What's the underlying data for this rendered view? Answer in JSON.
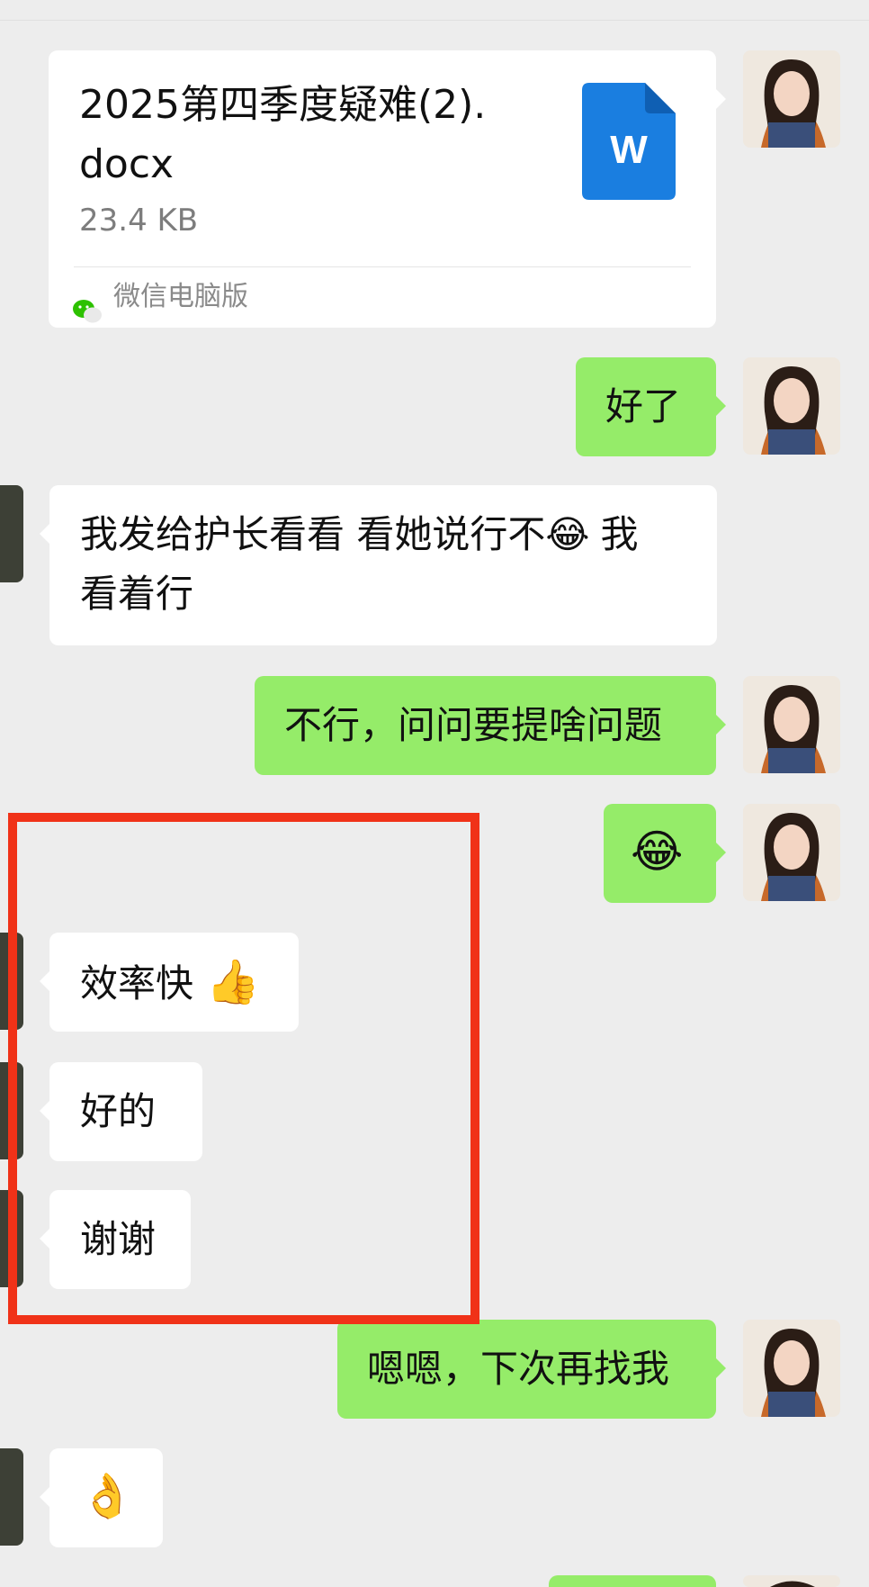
{
  "messages": {
    "file_card": {
      "file_name_line1": "2025第四季度疑难(2).",
      "file_name_line2": "docx",
      "file_size": "23.4 KB",
      "file_icon_letter": "W",
      "source_label": "微信电脑版"
    },
    "msg_done": "好了",
    "msg_nurse_line1": "我发给护长看看 看她说行不",
    "msg_nurse_line1b": "我",
    "msg_nurse_line2": "看着行",
    "msg_ask": "不行，问问要提啥问题",
    "msg_efficient": "效率快",
    "msg_ok": "好的",
    "msg_thanks": "谢谢",
    "msg_next_time": "嗯嗯，下次再找我"
  },
  "icons": {
    "laugh_emoji": "😂",
    "thumbs_up_emoji": "👍",
    "ok_hand_emoji": "👌"
  },
  "colors": {
    "background": "#ededed",
    "sent_bubble": "#95ec69",
    "received_bubble": "#ffffff",
    "word_icon": "#1a7ee0",
    "highlight_box": "#f03218"
  }
}
